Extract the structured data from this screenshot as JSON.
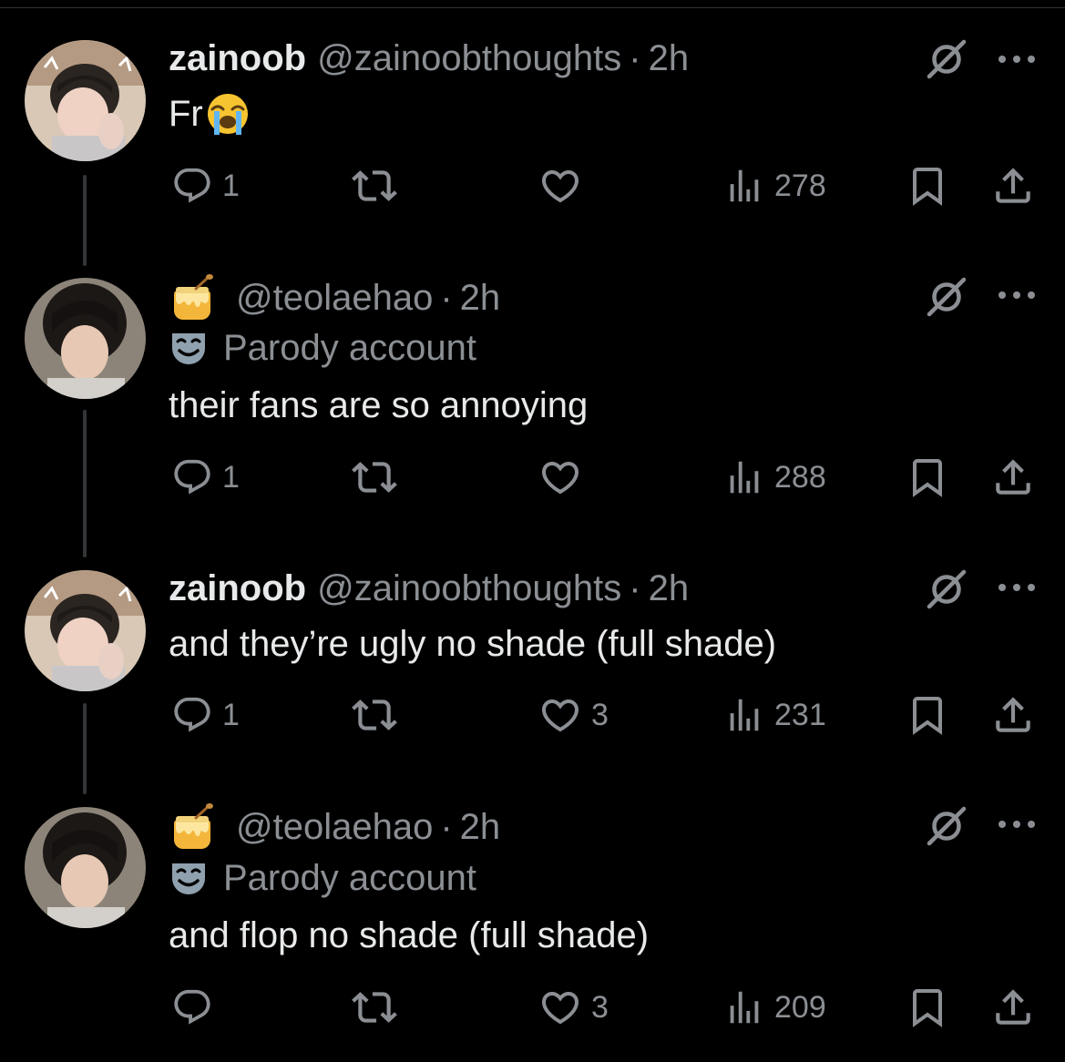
{
  "tweets": [
    {
      "display_name": "zainoob",
      "handle": "@zainoobthoughts",
      "separator": "·",
      "time": "2h",
      "text": "Fr",
      "has_cry_emoji": true,
      "replies": "1",
      "likes": "",
      "views": "278"
    },
    {
      "display_name": "",
      "handle": "@teolaehao",
      "separator": "·",
      "time": "2h",
      "parody_label": "Parody account",
      "text": "their fans are so annoying",
      "replies": "1",
      "likes": "",
      "views": "288"
    },
    {
      "display_name": "zainoob",
      "handle": "@zainoobthoughts",
      "separator": "·",
      "time": "2h",
      "text": "and they’re ugly no shade (full shade)",
      "replies": "1",
      "likes": "3",
      "views": "231"
    },
    {
      "display_name": "",
      "handle": "@teolaehao",
      "separator": "·",
      "time": "2h",
      "parody_label": "Parody account",
      "text": "and flop no shade (full shade)",
      "replies": "",
      "likes": "3",
      "views": "209"
    }
  ],
  "colors": {
    "background": "#000000",
    "text": "#e7e9ea",
    "secondary": "#8b8f94",
    "thread_line": "#333639"
  },
  "icons": [
    "reply-icon",
    "retweet-icon",
    "like-icon",
    "views-icon",
    "bookmark-icon",
    "share-icon",
    "grok-icon",
    "more-icon",
    "honey-pot-emoji",
    "parody-mask-icon",
    "loudly-crying-emoji"
  ]
}
